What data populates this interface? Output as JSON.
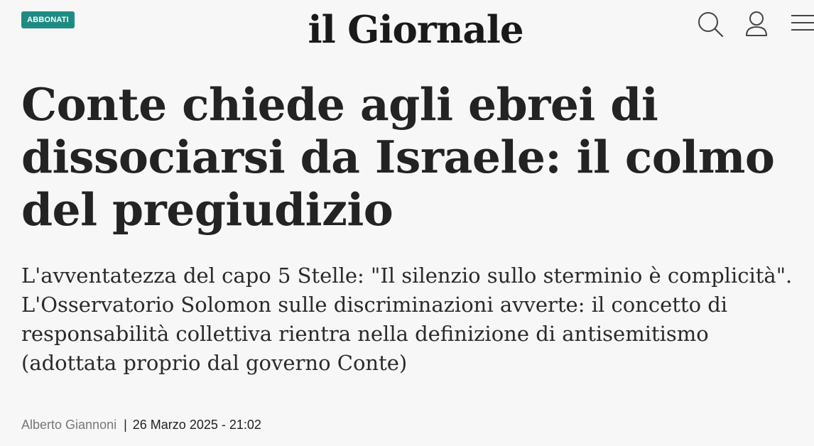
{
  "header": {
    "badge_label": "ABBONATI",
    "logo_text": "il Giornale",
    "icons": {
      "search": "search-icon",
      "user": "user-icon",
      "menu": "hamburger-menu-icon"
    }
  },
  "article": {
    "headline": "Conte chiede agli ebrei di dissociarsi da Israele: il colmo del pregiudizio",
    "subheadline": "L'avventatezza del capo 5 Stelle: \"Il silenzio sullo sterminio è complicità\". L'Osservatorio Solomon sulle discriminazioni avverte: il concetto di responsabilità collettiva rientra nella definizione di antisemitismo (adottata proprio dal governo Conte)",
    "author": "Alberto Giannoni",
    "separator": "|",
    "date": "26 Marzo 2025 - 21:02"
  },
  "colors": {
    "background": "#f7f7f7",
    "badge": "#1f8c84",
    "text": "#222222",
    "author_text": "#777777"
  }
}
